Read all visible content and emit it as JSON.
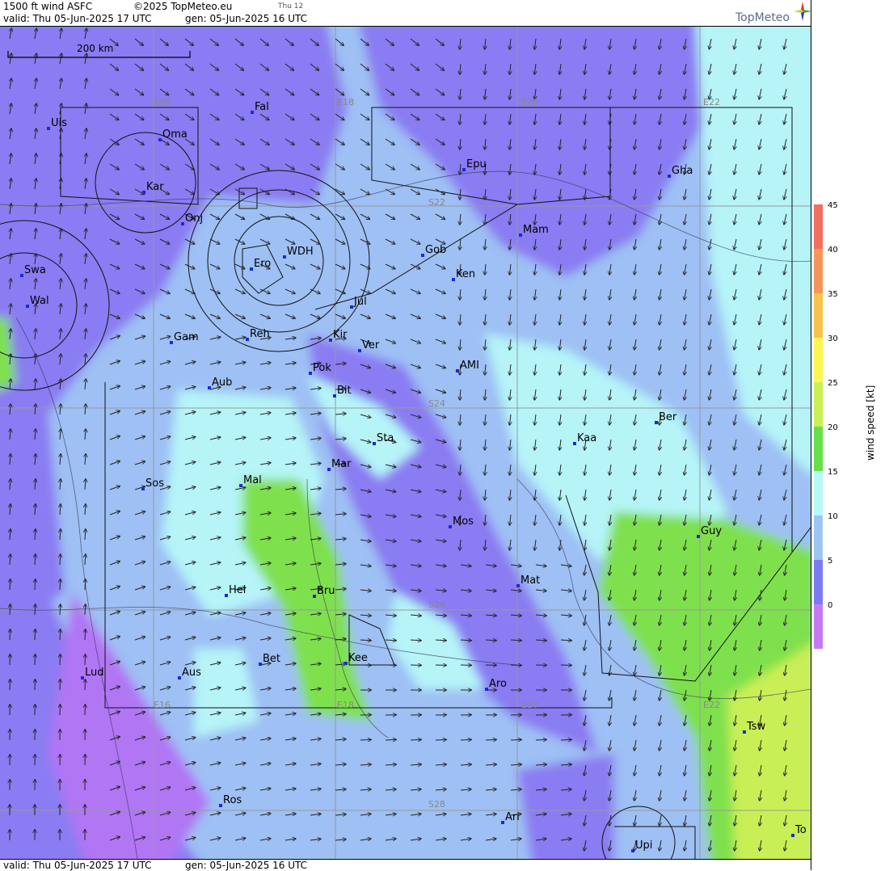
{
  "header": {
    "product": "1500 ft wind ASFC",
    "copyright": "©2025 TopMeteo.eu",
    "day_short": "Thu 12",
    "valid": "valid:  Thu  05-Jun-2025  17 UTC",
    "gen": "gen: 05-Jun-2025 16 UTC",
    "logo_text": "TopMeteo"
  },
  "footer": {
    "valid": "valid:  Thu  05-Jun-2025  17 UTC",
    "gen": "gen: 05-Jun-2025 16 UTC"
  },
  "scale_bar": "200 km",
  "grid_labels": {
    "lon": [
      "E16",
      "E18",
      "E20",
      "E22"
    ],
    "lat": [
      "S22",
      "S24",
      "S26",
      "S28"
    ]
  },
  "places": [
    "Uis",
    "Fal",
    "Oma",
    "Kar",
    "Onj",
    "Epu",
    "Gha",
    "Mam",
    "Gob",
    "WDH",
    "Ero",
    "Ken",
    "Swa",
    "Wal",
    "Jul",
    "Gam",
    "Reh",
    "Kir",
    "Ver",
    "AMI",
    "Pok",
    "Bit",
    "Aub",
    "Ber",
    "Kaa",
    "Sta",
    "Mar",
    "Sos",
    "Mal",
    "Mos",
    "Guy",
    "Mat",
    "Hel",
    "Bru",
    "Bet",
    "Kee",
    "Aus",
    "Lud",
    "Aro",
    "Tsw",
    "Ros",
    "Ari",
    "Upi",
    "To"
  ],
  "colorbar": {
    "title": "wind  speed  [kt]",
    "ticks": [
      "45",
      "40",
      "35",
      "30",
      "25",
      "20",
      "15",
      "10",
      "5",
      "0"
    ],
    "colors": [
      "#f07060",
      "#f5955a",
      "#f7c24e",
      "#fef650",
      "#c9ef56",
      "#66e04a",
      "#b8f8f8",
      "#9ec4f2",
      "#7a7cf2",
      "#c57af4"
    ]
  },
  "legend_colors": {
    "purple": "#8f7cf2",
    "blue": "#9ec0f4",
    "cyan": "#b6f4f8",
    "green": "#7fe04e",
    "violet": "#b176f4"
  }
}
